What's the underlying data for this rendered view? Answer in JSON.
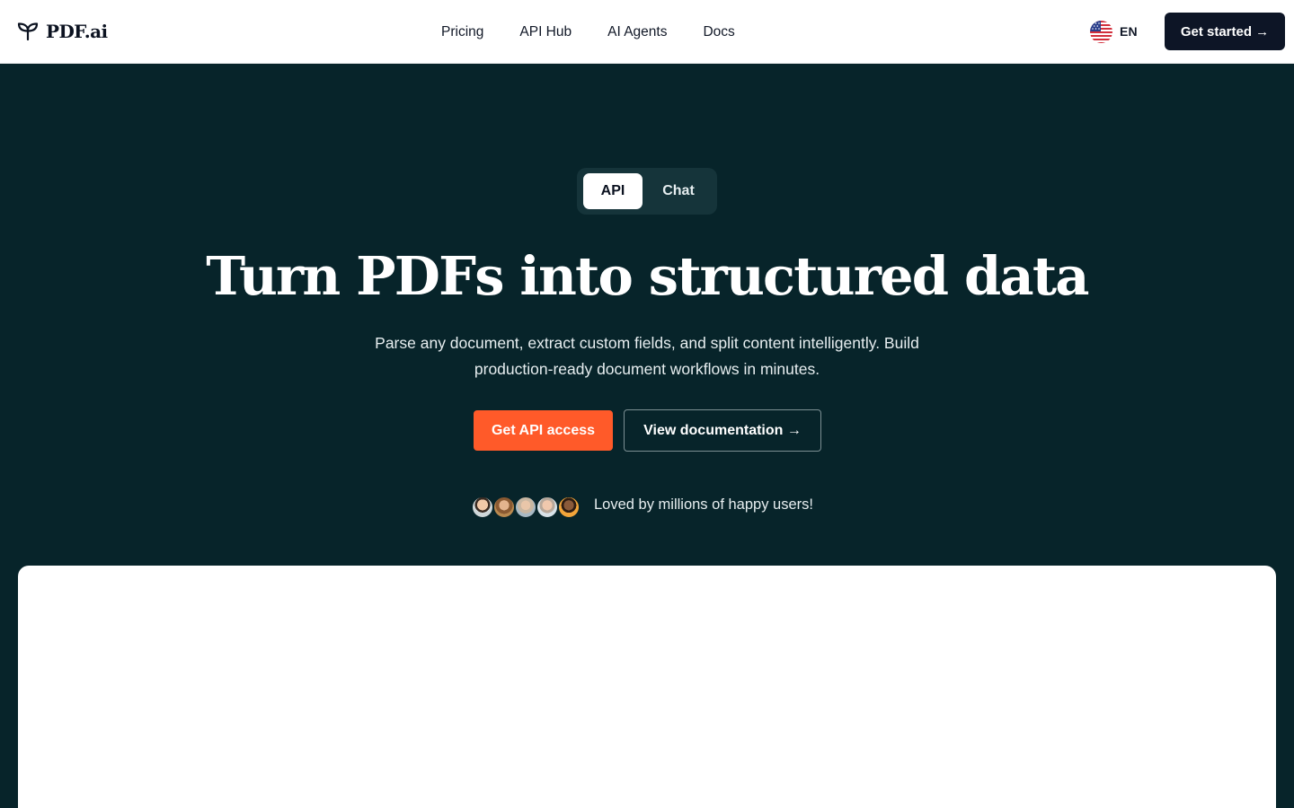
{
  "header": {
    "logo_text": "PDF.ai",
    "nav": [
      {
        "label": "Pricing"
      },
      {
        "label": "API Hub"
      },
      {
        "label": "AI Agents"
      },
      {
        "label": "Docs"
      }
    ],
    "language": "EN",
    "cta_label": "Get started →"
  },
  "hero": {
    "toggle": {
      "api_label": "API",
      "chat_label": "Chat",
      "active": "API"
    },
    "title": "Turn PDFs into structured data",
    "subtitle_line1": "Parse any document, extract custom fields, and split content intelligently. Build",
    "subtitle_line2": "production-ready document workflows in minutes.",
    "primary_cta": "Get API access",
    "secondary_cta": "View documentation →",
    "social_proof": "Loved by millions of happy users!"
  },
  "colors": {
    "hero_bg": "#07242a",
    "accent": "#ff5a29",
    "header_cta_bg": "#0d1526"
  }
}
